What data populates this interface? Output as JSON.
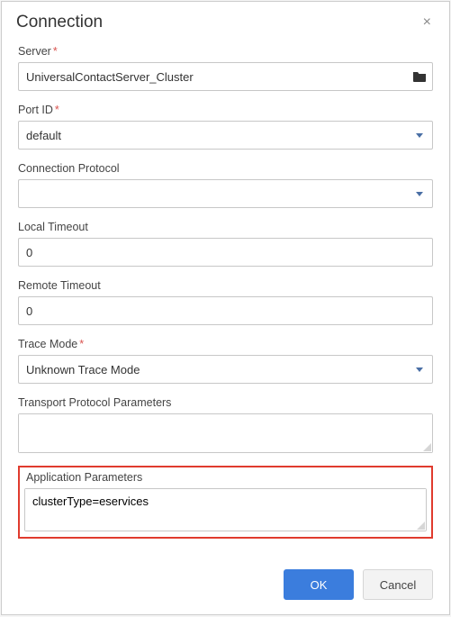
{
  "dialog": {
    "title": "Connection",
    "close_label": "×"
  },
  "fields": {
    "server": {
      "label": "Server",
      "required_marker": "*",
      "value": "UniversalContactServer_Cluster"
    },
    "port_id": {
      "label": "Port ID",
      "required_marker": "*",
      "value": "default"
    },
    "connection_protocol": {
      "label": "Connection Protocol",
      "value": ""
    },
    "local_timeout": {
      "label": "Local Timeout",
      "value": "0"
    },
    "remote_timeout": {
      "label": "Remote Timeout",
      "value": "0"
    },
    "trace_mode": {
      "label": "Trace Mode",
      "required_marker": "*",
      "value": "Unknown Trace Mode"
    },
    "transport_protocol_parameters": {
      "label": "Transport Protocol Parameters",
      "value": ""
    },
    "application_parameters": {
      "label": "Application Parameters",
      "value": "clusterType=eservices"
    }
  },
  "buttons": {
    "ok": "OK",
    "cancel": "Cancel"
  }
}
